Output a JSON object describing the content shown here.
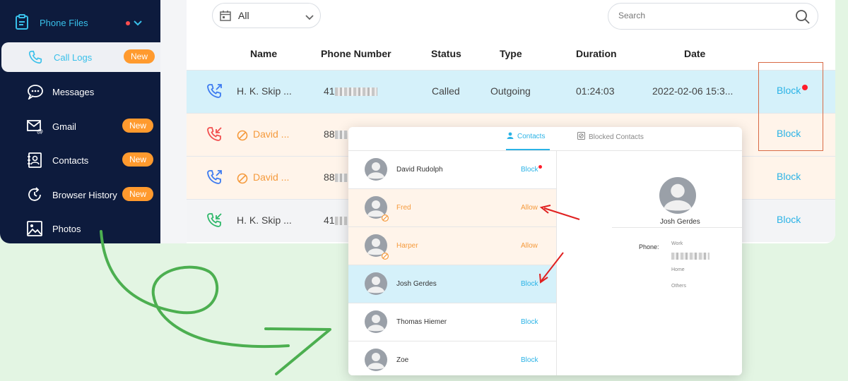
{
  "sidebar": {
    "header": "Phone Files",
    "items": [
      {
        "label": "Call Logs",
        "badge": "New",
        "icon": "phone-icon"
      },
      {
        "label": "Messages",
        "badge": "",
        "icon": "chat-icon"
      },
      {
        "label": "Gmail",
        "badge": "New",
        "icon": "mail-icon"
      },
      {
        "label": "Contacts",
        "badge": "New",
        "icon": "contacts-icon"
      },
      {
        "label": "Browser History",
        "badge": "New",
        "icon": "history-icon"
      },
      {
        "label": "Photos",
        "badge": "",
        "icon": "photo-icon"
      }
    ]
  },
  "filter": {
    "value": "All"
  },
  "search": {
    "placeholder": "Search"
  },
  "columns": [
    "Name",
    "Phone Number",
    "Status",
    "Type",
    "Duration",
    "Date"
  ],
  "rows": [
    {
      "name": "H. K. Skip ...",
      "phone_prefix": "41",
      "status": "Called",
      "type": "Outgoing",
      "duration": "01:24:03",
      "date": "2022-02-06 15:3...",
      "action": "Block",
      "icon": "outgoing-call-icon"
    },
    {
      "name": "David ...",
      "phone_prefix": "88",
      "status": "",
      "type": "",
      "duration": "",
      "date": "",
      "action": "Block",
      "icon": "missed-call-icon"
    },
    {
      "name": "David ...",
      "phone_prefix": "88",
      "status": "",
      "type": "",
      "duration": "",
      "date": "",
      "action": "Block",
      "icon": "outgoing-call-icon"
    },
    {
      "name": "H. K. Skip ...",
      "phone_prefix": "41",
      "status": "",
      "type": "",
      "duration": "",
      "date": "",
      "action": "Block",
      "icon": "incoming-call-icon"
    }
  ],
  "contacts_card": {
    "tabs": [
      "Contacts",
      "Blocked Contacts"
    ],
    "contacts": [
      {
        "name": "David Rudolph",
        "action": "Block"
      },
      {
        "name": "Fred",
        "action": "Allow"
      },
      {
        "name": "Harper",
        "action": "Allow"
      },
      {
        "name": "Josh Gerdes",
        "action": "Block"
      },
      {
        "name": "Thomas Hiemer",
        "action": "Block"
      },
      {
        "name": "Zoe",
        "action": "Block"
      }
    ],
    "detail": {
      "name": "Josh Gerdes",
      "phone_label": "Phone:",
      "fields": [
        "Work",
        "Home",
        "Others"
      ]
    }
  },
  "colors": {
    "sidebar_bg": "#0d1b3d",
    "accent": "#2bb3e6",
    "badge": "#ff9a2e",
    "blocked": "#f59a3c",
    "selected_row": "#d5f1fa",
    "annotation_red": "#e02020",
    "annotation_green": "#4caf50"
  }
}
